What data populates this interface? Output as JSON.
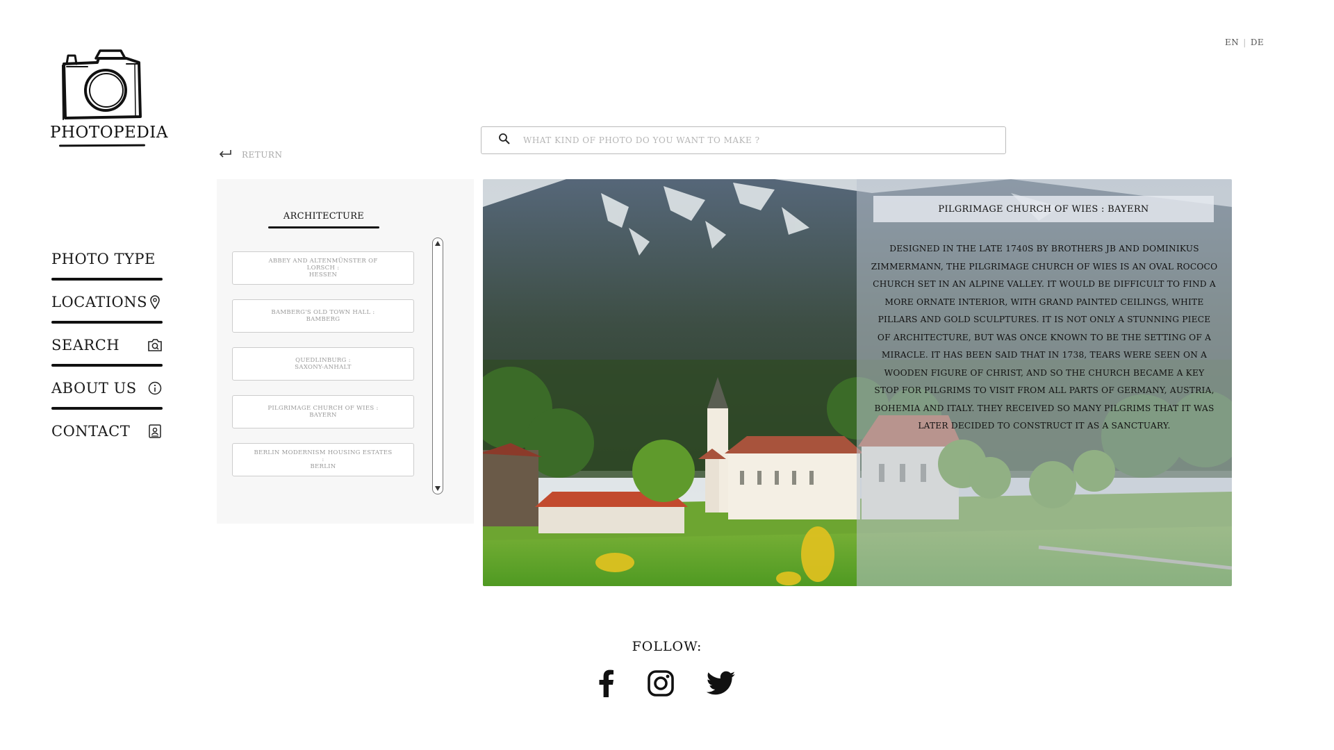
{
  "lang": {
    "en": "EN",
    "separator": "|",
    "de": "DE"
  },
  "logo": {
    "text": "PHOTOPEDIA"
  },
  "nav": {
    "items": [
      {
        "label": "PHOTO TYPE",
        "icon": "none"
      },
      {
        "label": "LOCATIONS",
        "icon": "location-pin-icon"
      },
      {
        "label": "SEARCH",
        "icon": "camera-search-icon"
      },
      {
        "label": "ABOUT US",
        "icon": "info-icon"
      },
      {
        "label": "CONTACT",
        "icon": "contact-card-icon"
      }
    ]
  },
  "search": {
    "placeholder": "WHAT KIND OF PHOTO DO YOU WANT TO MAKE ?"
  },
  "return": {
    "label": "RETURN"
  },
  "category": {
    "title": "ARCHITECTURE",
    "items": [
      {
        "line1": "ABBEY AND ALTENMÜNSTER OF LORSCH :",
        "line2": "HESSEN"
      },
      {
        "line1": "BAMBERG'S OLD TOWN HALL :",
        "line2": "BAMBERG"
      },
      {
        "line1": "QUEDLINBURG :",
        "line2": "SAXONY-ANHALT"
      },
      {
        "line1": "PILGRIMAGE CHURCH OF WIES :",
        "line2": "BAYERN"
      },
      {
        "line1": "BERLIN MODERNISM HOUSING ESTATES :",
        "line2": "BERLIN"
      }
    ]
  },
  "info": {
    "title": "PILGRIMAGE CHURCH OF WIES : BAYERN",
    "text": "DESIGNED IN THE LATE 1740S BY BROTHERS JB AND DOMINIKUS ZIMMERMANN, THE PILGRIMAGE CHURCH OF WIES IS AN OVAL ROCOCO CHURCH SET IN AN ALPINE VALLEY. IT WOULD BE DIFFICULT TO FIND A MORE ORNATE INTERIOR, WITH GRAND PAINTED CEILINGS, WHITE PILLARS AND GOLD SCULPTURES. IT IS NOT ONLY A STUNNING PIECE OF ARCHITECTURE, BUT WAS ONCE KNOWN TO BE THE SETTING OF A MIRACLE. IT HAS BEEN SAID THAT IN 1738, TEARS WERE SEEN ON A WOODEN FIGURE OF CHRIST, AND SO THE CHURCH BECAME A KEY STOP FOR PILGRIMS TO VISIT FROM ALL PARTS OF GERMANY, AUSTRIA, BOHEMIA AND ITALY. THEY RECEIVED SO MANY PILGRIMS THAT IT WAS LATER DECIDED TO CONSTRUCT IT AS A SANCTUARY."
  },
  "footer": {
    "follow_label": "FOLLOW:",
    "social": [
      "facebook-icon",
      "instagram-icon",
      "twitter-icon"
    ]
  }
}
